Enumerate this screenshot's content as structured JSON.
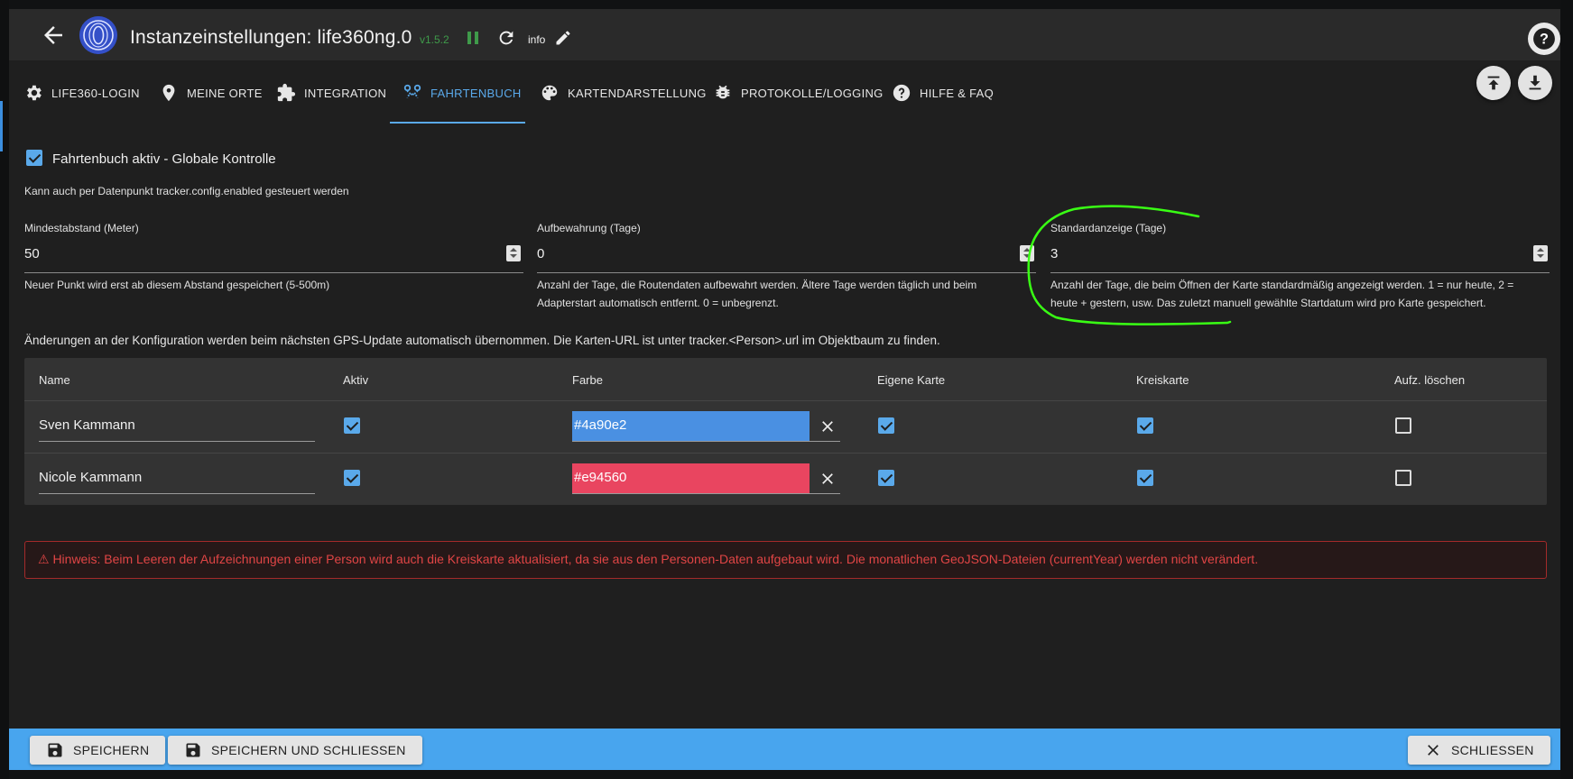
{
  "header": {
    "title": "Instanzeinstellungen: life360ng.0",
    "version": "v1.5.2",
    "info_label": "info",
    "help_symbol": "?"
  },
  "tabs": [
    {
      "label": "LIFE360-LOGIN",
      "icon": "gear-icon"
    },
    {
      "label": "MEINE ORTE",
      "icon": "location-pin-icon"
    },
    {
      "label": "INTEGRATION",
      "icon": "puzzle-icon"
    },
    {
      "label": "FAHRTENBUCH",
      "icon": "route-icon",
      "active": true
    },
    {
      "label": "KARTENDARSTELLUNG",
      "icon": "palette-icon"
    },
    {
      "label": "PROTOKOLLE/LOGGING",
      "icon": "bug-icon"
    },
    {
      "label": "HILFE & FAQ",
      "icon": "help-circle-icon"
    }
  ],
  "global": {
    "checkbox_label": "Fahrtenbuch aktiv - Globale Kontrolle",
    "checked": true,
    "hint": "Kann auch per Datenpunkt tracker.config.enabled gesteuert werden"
  },
  "fields": {
    "min_distance": {
      "label": "Mindestabstand (Meter)",
      "value": "50",
      "help": "Neuer Punkt wird erst ab diesem Abstand gespeichert (5-500m)"
    },
    "retention": {
      "label": "Aufbewahrung (Tage)",
      "value": "0",
      "help_1": "Anzahl der Tage, die Routendaten aufbewahrt werden. Ältere Tage werden täglich und beim",
      "help_2": "Adapterstart automatisch entfernt. 0 = unbegrenzt."
    },
    "default_days": {
      "label": "Standardanzeige (Tage)",
      "value": "3",
      "help_1": "Anzahl der Tage, die beim Öffnen der Karte standardmäßig angezeigt werden. 1 = nur heute, 2 =",
      "help_2": "heute + gestern, usw. Das zuletzt manuell gewählte Startdatum wird pro Karte gespeichert."
    }
  },
  "info_line": "Änderungen an der Konfiguration werden beim nächsten GPS-Update automatisch übernommen. Die Karten-URL ist unter tracker.<Person>.url im Objektbaum zu finden.",
  "table": {
    "headers": [
      "Name",
      "Aktiv",
      "Farbe",
      "Eigene Karte",
      "Kreiskarte",
      "Aufz. löschen"
    ],
    "rows": [
      {
        "name": "Sven Kammann",
        "active": true,
        "color": "#4a90e2",
        "own_map": true,
        "circle_map": true,
        "clear": false
      },
      {
        "name": "Nicole Kammann",
        "active": true,
        "color": "#e94560",
        "own_map": true,
        "circle_map": true,
        "clear": false
      }
    ]
  },
  "warning": "⚠ Hinweis: Beim Leeren der Aufzeichnungen einer Person wird auch die Kreiskarte aktualisiert, da sie aus den Personen-Daten aufgebaut wird. Die monatlichen GeoJSON-Dateien (currentYear) werden nicht verändert.",
  "footer": {
    "save": "SPEICHERN",
    "save_close": "SPEICHERN UND SCHLIESSEN",
    "close": "SCHLIESSEN"
  },
  "colors": {
    "accent": "#5aa9ea",
    "footer": "#48a5ee",
    "warning": "#e04545",
    "version": "#3f9a4a",
    "annotation": "#39ff14"
  }
}
